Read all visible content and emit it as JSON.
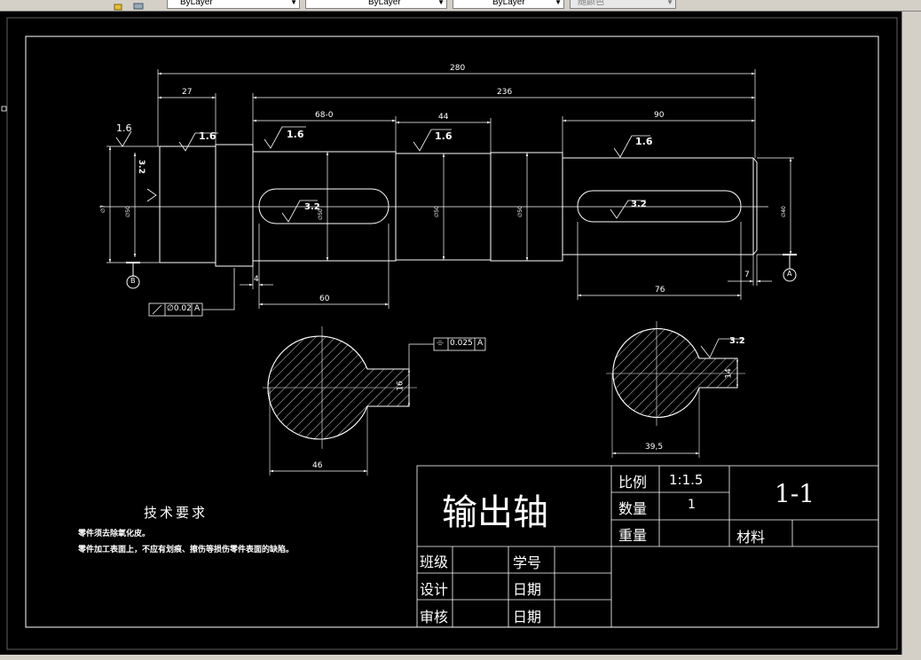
{
  "toolbar": {
    "color_control": "ByLayer",
    "linetype_control": "ByLayer",
    "lineweight_control": "ByLayer",
    "plotstyle_control": "随颜色"
  },
  "dims": {
    "d280": "280",
    "d27": "27",
    "d236": "236",
    "d68": "68-0",
    "d44": "44",
    "d90": "90",
    "d60": "60",
    "d4": "4",
    "d76": "76",
    "d7": "7",
    "d16": "16",
    "d46": "46",
    "d14": "14",
    "d395": "39,5"
  },
  "roughness": {
    "r16a": "1.6",
    "r16b": "1.6",
    "r16c": "1.6",
    "r16d": "1.6",
    "r16e": "1.6",
    "r32a": "3.2",
    "r32b": "3.2",
    "r32c": "3.2",
    "r32d": "3.2"
  },
  "datums": {
    "a": "A",
    "b": "B"
  },
  "tolerance": {
    "runout_value": "∅0.02",
    "runout_datum": "A",
    "symmetry_value": "0.025",
    "symmetry_datum": "A"
  },
  "tech_req": {
    "title": "技术要求",
    "line1": "零件须去除氧化皮。",
    "line2": "零件加工表面上，不应有划痕、擦伤等损伤零件表面的缺陷。"
  },
  "title_block": {
    "part_name": "输出轴",
    "scale_label": "比例",
    "scale_value": "1:1.5",
    "qty_label": "数量",
    "qty_value": "1",
    "weight_label": "重量",
    "drawing_no": "1-1",
    "material_label": "材料",
    "class_label": "班级",
    "student_no_label": "学号",
    "design_label": "设计",
    "date_label1": "日期",
    "review_label": "审核",
    "date_label2": "日期"
  }
}
